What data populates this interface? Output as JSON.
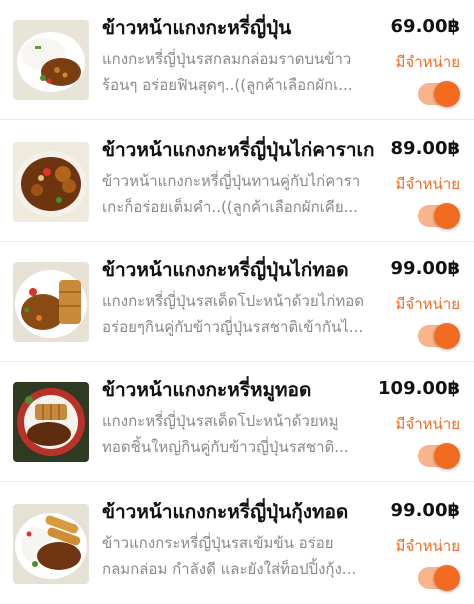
{
  "menu": {
    "items": [
      {
        "name": "ข้าวหน้าแกงกะหรี่ญี่ปุ่น",
        "desc_line1": "แกงกะหรี่ญี่ปุ่นรสกลมกล่อมราดบนข้าว",
        "desc_line2": "ร้อนๆ อร่อยฟินสุดๆ..((ลูกค้าเลือกผักเ...",
        "price": "69.00฿",
        "status": "มีจำหน่าย",
        "available": true,
        "image_icon": "curry-rice-dish"
      },
      {
        "name": "ข้าวหน้าแกงกะหรี่ญี่ปุ่นไก่คาราเกะ",
        "desc_line1": "ข้าวหน้าแกงกะหรี่ญี่ปุ่นทานคู่กับไก่คารา",
        "desc_line2": "เกะก็อร่อยเต็มคำ..((ลูกค้าเลือกผักเคีย...",
        "price": "89.00฿",
        "status": "มีจำหน่าย",
        "available": true,
        "image_icon": "karaage-curry-dish"
      },
      {
        "name": "ข้าวหน้าแกงกะหรี่ญี่ปุ่นไก่ทอด",
        "desc_line1": "แกงกะหรี่ญี่ปุ่นรสเด็ดโปะหน้าด้วยไก่ทอด",
        "desc_line2": "อร่อยๆกินคู่กับข้าวญี่ปุ่นรสชาติเข้ากันไ...",
        "price": "99.00฿",
        "status": "มีจำหน่าย",
        "available": true,
        "image_icon": "fried-chicken-curry-dish"
      },
      {
        "name": "ข้าวหน้าแกงกะหรี่หมูทอด",
        "desc_line1": "แกงกะหรี่ญี่ปุ่นรสเด็ดโปะหน้าด้วยหมู",
        "desc_line2": "ทอดชิ้นใหญ่กินคู่กับข้าวญี่ปุ่นรสชาติ...",
        "price": "109.00฿",
        "status": "มีจำหน่าย",
        "available": true,
        "image_icon": "pork-cutlet-curry-dish"
      },
      {
        "name": "ข้าวหน้าแกงกะหรี่ญี่ปุ่นกุ้งทอด",
        "desc_line1": "ข้าวแกงกระหรี่ญี่ปุ่นรสเข้มข้น อร่อย",
        "desc_line2": "กลมกล่อม กำลังดี และยังใส่ท็อปปิ้งกุ้ง...",
        "price": "99.00฿",
        "status": "มีจำหน่าย",
        "available": true,
        "image_icon": "fried-shrimp-curry-dish"
      }
    ]
  },
  "colors": {
    "accent": "#f26b21",
    "toggle_track": "#f8b48a",
    "text": "#111111",
    "muted": "#8a8a8a"
  }
}
